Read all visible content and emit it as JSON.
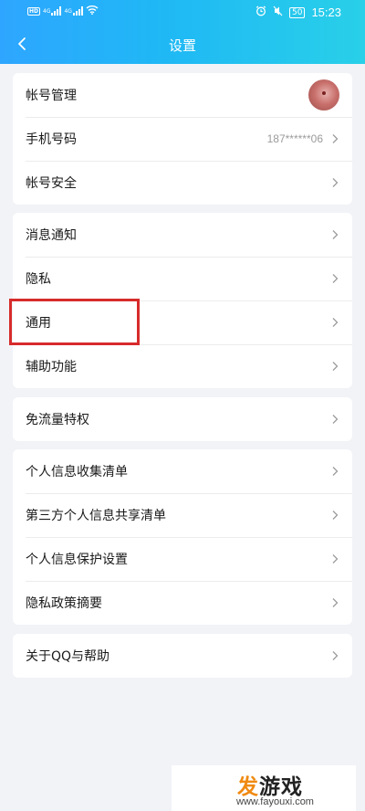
{
  "status_bar": {
    "left_badges": [
      "HD",
      "HD"
    ],
    "net_tags": [
      "4G",
      "4G"
    ],
    "battery": "50",
    "time": "15:23"
  },
  "nav": {
    "back_icon": "chevron-left-icon",
    "title": "设置"
  },
  "groups": [
    {
      "items": [
        {
          "label": "帐号管理",
          "value": "",
          "trailing": "avatar"
        },
        {
          "label": "手机号码",
          "value": "187******06",
          "trailing": "chevron-right-icon"
        },
        {
          "label": "帐号安全",
          "value": "",
          "trailing": "chevron-right-icon"
        }
      ]
    },
    {
      "items": [
        {
          "label": "消息通知",
          "value": "",
          "trailing": "chevron-right-icon"
        },
        {
          "label": "隐私",
          "value": "",
          "trailing": "chevron-right-icon"
        },
        {
          "label": "通用",
          "value": "",
          "trailing": "chevron-right-icon",
          "highlighted": true
        },
        {
          "label": "辅助功能",
          "value": "",
          "trailing": "chevron-right-icon"
        }
      ]
    },
    {
      "items": [
        {
          "label": "免流量特权",
          "value": "",
          "trailing": "chevron-right-icon"
        }
      ]
    },
    {
      "items": [
        {
          "label": "个人信息收集清单",
          "value": "",
          "trailing": "chevron-right-icon"
        },
        {
          "label": "第三方个人信息共享清单",
          "value": "",
          "trailing": "chevron-right-icon"
        },
        {
          "label": "个人信息保护设置",
          "value": "",
          "trailing": "chevron-right-icon"
        },
        {
          "label": "隐私政策摘要",
          "value": "",
          "trailing": "chevron-right-icon"
        }
      ]
    },
    {
      "items": [
        {
          "label": "关于QQ与帮助",
          "value": "",
          "trailing": "chevron-right-icon"
        }
      ]
    }
  ],
  "watermark": {
    "title": "发游戏",
    "title_accent": "发",
    "title_rest": "游戏",
    "url": "www.fayouxi.com"
  },
  "colors": {
    "header_start": "#2ea6ff",
    "header_end": "#29d0e8",
    "highlight_box": "#d72b2b",
    "watermark_accent": "#f08a12"
  }
}
